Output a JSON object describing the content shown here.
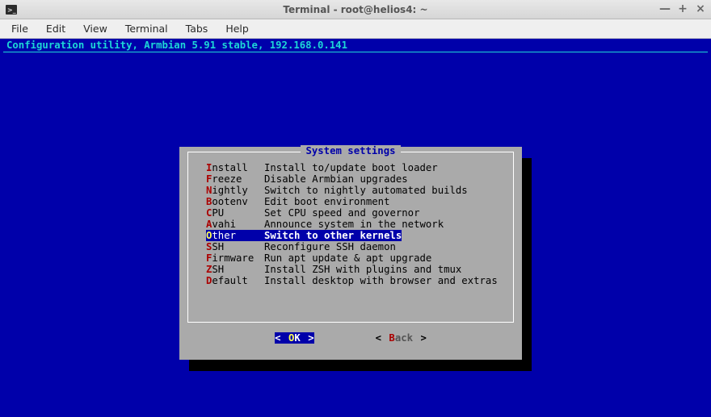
{
  "window": {
    "title": "Terminal - root@helios4: ~",
    "controls": {
      "min": "—",
      "max": "+",
      "close": "×"
    }
  },
  "menubar": {
    "file": "File",
    "edit": "Edit",
    "view": "View",
    "terminal": "Terminal",
    "tabs": "Tabs",
    "help": "Help"
  },
  "config_header": "Configuration utility, Armbian 5.91 stable, 192.168.0.141",
  "dialog": {
    "title": "System settings",
    "items": [
      {
        "hk": "I",
        "rest": "nstall",
        "name": "Install",
        "pad": "  ",
        "desc": "Install to/update boot loader",
        "selected": false
      },
      {
        "hk": "F",
        "rest": "reeze",
        "name": "Freeze",
        "pad": "   ",
        "desc": "Disable Armbian upgrades",
        "selected": false
      },
      {
        "hk": "N",
        "rest": "ightly",
        "name": "Nightly",
        "pad": "  ",
        "desc": "Switch to nightly automated builds",
        "selected": false
      },
      {
        "hk": "B",
        "rest": "ootenv",
        "name": "Bootenv",
        "pad": "  ",
        "desc": "Edit boot environment",
        "selected": false
      },
      {
        "hk": "C",
        "rest": "PU",
        "name": "CPU",
        "pad": "      ",
        "desc": "Set CPU speed and governor",
        "selected": false
      },
      {
        "hk": "A",
        "rest": "vahi",
        "name": "Avahi",
        "pad": "    ",
        "desc": "Announce system in the network",
        "selected": false
      },
      {
        "hk": "O",
        "rest": "ther",
        "name": "Other",
        "pad": "    ",
        "desc": "Switch to other kernels",
        "selected": true
      },
      {
        "hk": "S",
        "rest": "SH",
        "name": "SSH",
        "pad": "      ",
        "desc": "Reconfigure SSH daemon",
        "selected": false
      },
      {
        "hk": "F",
        "rest": "irmware",
        "name": "Firmware",
        "pad": " ",
        "desc": "Run apt update & apt upgrade",
        "selected": false
      },
      {
        "hk": "Z",
        "rest": "SH",
        "name": "ZSH",
        "pad": "      ",
        "desc": "Install ZSH with plugins and tmux",
        "selected": false
      },
      {
        "hk": "D",
        "rest": "efault",
        "name": "Default",
        "pad": "  ",
        "desc": "Install desktop with browser and extras",
        "selected": false
      }
    ],
    "buttons": {
      "ok": {
        "pre": "O",
        "rest": "K"
      },
      "back": {
        "pre": "B",
        "rest": "ack"
      },
      "angle_l": "<",
      "angle_r": ">"
    }
  }
}
